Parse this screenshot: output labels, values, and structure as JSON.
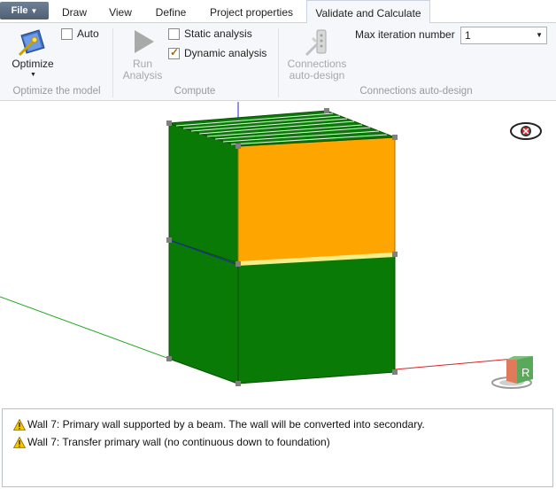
{
  "tabs": {
    "file": "File",
    "items": [
      "Draw",
      "View",
      "Define",
      "Project properties",
      "Validate and Calculate"
    ],
    "active_index": 4
  },
  "ribbon": {
    "optimize": {
      "button_label": "Optimize",
      "auto_label": "Auto",
      "auto_checked": false,
      "group_label": "Optimize the model"
    },
    "compute": {
      "run_label_line1": "Run",
      "run_label_line2": "Analysis",
      "static_label": "Static analysis",
      "static_checked": false,
      "dynamic_label": "Dynamic analysis",
      "dynamic_checked": true,
      "group_label": "Compute"
    },
    "connections": {
      "button_line1": "Connections",
      "button_line2": "auto-design",
      "max_iter_label": "Max iteration number",
      "max_iter_value": "1",
      "group_label": "Connections auto-design"
    }
  },
  "viewport": {
    "colors": {
      "wall_green": "#0a7a06",
      "wall_orange": "#ffa500",
      "highlight_beam": "#f2ee8a",
      "axis_red": "#e02020",
      "axis_green": "#22aa22",
      "axis_blue": "#2020e0"
    },
    "visibility_icon": "eye-hidden-icon",
    "navigation_cube_letter": "R"
  },
  "messages": [
    "Wall 7: Primary wall supported by a beam. The wall will be converted into secondary.",
    "Wall 7: Transfer primary wall (no continuous down to foundation)"
  ]
}
